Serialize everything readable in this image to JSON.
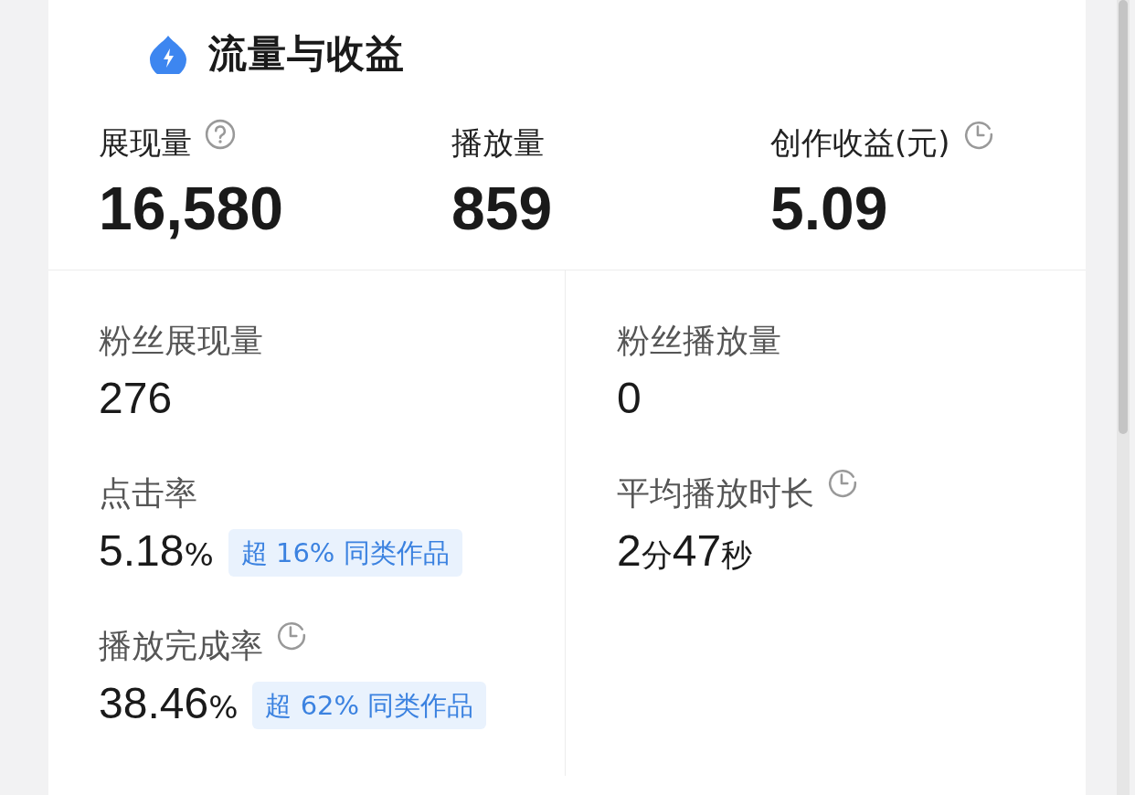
{
  "header": {
    "title": "流量与收益"
  },
  "summary": [
    {
      "kind": "help",
      "label": "展现量",
      "value": "16,580"
    },
    {
      "kind": "plain",
      "label": "播放量",
      "value": "859"
    },
    {
      "kind": "clock",
      "label": "创作收益(元)",
      "value": "5.09"
    }
  ],
  "details": [
    [
      {
        "kind": "plain",
        "label": "粉丝展现量",
        "value": [
          {
            "text": "276",
            "kind": "number"
          }
        ]
      },
      {
        "kind": "plain",
        "label": "点击率",
        "value": [
          {
            "text": "5.18",
            "kind": "number"
          },
          {
            "text": "%",
            "kind": "unit"
          }
        ],
        "badge": "超 16% 同类作品"
      },
      {
        "kind": "clock",
        "label": "播放完成率",
        "value": [
          {
            "text": "38.46",
            "kind": "number"
          },
          {
            "text": "%",
            "kind": "unit"
          }
        ],
        "badge": "超 62% 同类作品"
      }
    ],
    [
      {
        "kind": "plain",
        "label": "粉丝播放量",
        "value": [
          {
            "text": "0",
            "kind": "number"
          }
        ]
      },
      {
        "kind": "clock",
        "label": "平均播放时长",
        "value": [
          {
            "text": "2",
            "kind": "number"
          },
          {
            "text": "分",
            "kind": "unit"
          },
          {
            "text": "47",
            "kind": "number"
          },
          {
            "text": "秒",
            "kind": "unit"
          }
        ]
      }
    ]
  ]
}
